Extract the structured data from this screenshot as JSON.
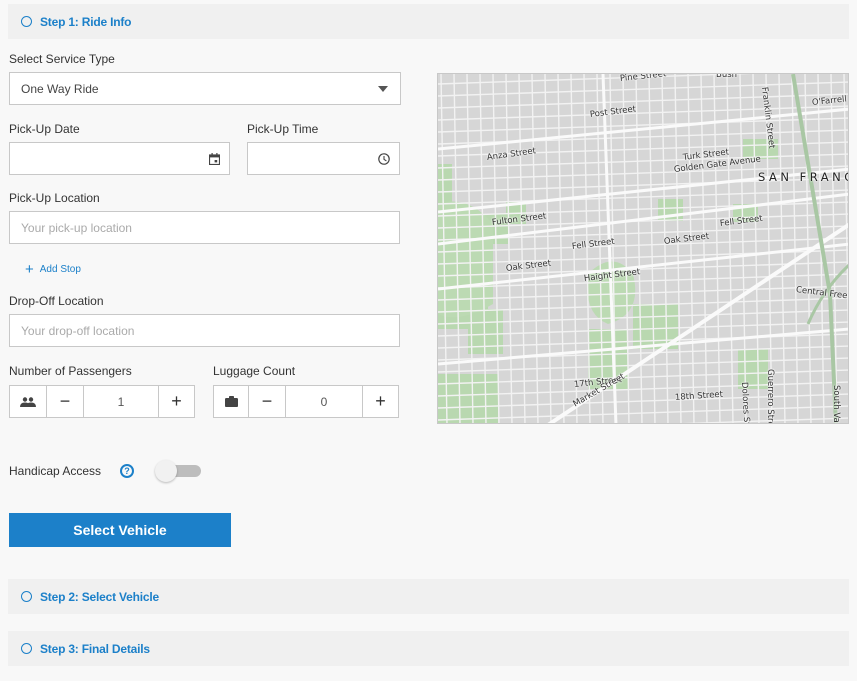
{
  "steps": [
    {
      "label": "Step 1: Ride Info",
      "icon": "circle-outline-icon"
    },
    {
      "label": "Step 2: Select Vehicle",
      "icon": "circle-outline-icon"
    },
    {
      "label": "Step 3: Final Details",
      "icon": "circle-outline-icon"
    }
  ],
  "form": {
    "service_type": {
      "label": "Select Service Type",
      "value": "One Way Ride",
      "icon": "caret-down-icon"
    },
    "pickup_date": {
      "label": "Pick-Up Date",
      "value": "",
      "icon": "calendar-icon"
    },
    "pickup_time": {
      "label": "Pick-Up Time",
      "value": "",
      "icon": "clock-icon"
    },
    "pickup_location": {
      "label": "Pick-Up Location",
      "placeholder": "Your pick-up location",
      "value": ""
    },
    "add_stop": {
      "label": "Add Stop",
      "icon": "plus-icon"
    },
    "dropoff_location": {
      "label": "Drop-Off Location",
      "placeholder": "Your drop-off location",
      "value": ""
    },
    "passengers": {
      "label": "Number of Passengers",
      "value": "1",
      "icon": "people-icon",
      "minus": "−",
      "plus": "+"
    },
    "luggage": {
      "label": "Luggage Count",
      "value": "0",
      "icon": "briefcase-icon",
      "minus": "−",
      "plus": "+"
    },
    "handicap": {
      "label": "Handicap Access",
      "help": "?",
      "enabled": false
    },
    "submit_label": "Select Vehicle"
  },
  "map": {
    "city_label": "SAN FRANC",
    "street_labels": [
      "Pine Street",
      "Bush",
      "Franklin Street",
      "O'Farrell",
      "Post Street",
      "Anza Street",
      "Turk Street",
      "Golden Gate Avenue",
      "Fulton Street",
      "Fell Street",
      "Fell Street",
      "Oak Street",
      "Oak Street",
      "Fell Street",
      "Haight Street",
      "Central Freew",
      "17th Street",
      "Market Street",
      "18th Street",
      "Dolores Str",
      "Guerrero Street",
      "South Van"
    ]
  },
  "colors": {
    "accent": "#1c80c9",
    "header_bg": "#f0f0f0",
    "page_bg": "#f8f8f8",
    "border": "#c8c8c8"
  }
}
